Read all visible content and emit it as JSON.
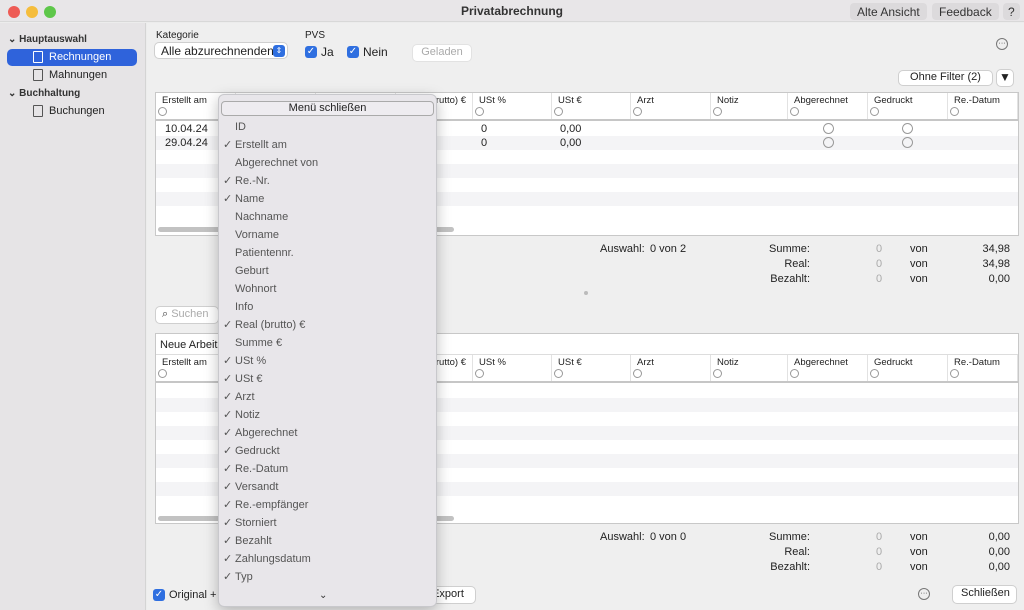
{
  "window": {
    "title": "Privatabrechnung",
    "buttons": [
      "Alte Ansicht",
      "Feedback",
      "?"
    ]
  },
  "sidebar": {
    "sections": [
      {
        "label": "Hauptauswahl",
        "items": [
          {
            "label": "Rechnungen",
            "selected": true,
            "icon": "invoice-icon"
          },
          {
            "label": "Mahnungen",
            "icon": "reminder-icon"
          }
        ]
      },
      {
        "label": "Buchhaltung",
        "items": [
          {
            "label": "Buchungen",
            "icon": "booking-icon"
          }
        ]
      }
    ]
  },
  "filters": {
    "kategorie_label": "Kategorie",
    "kategorie_value": "Alle abzurechnenden",
    "pvs_label": "PVS",
    "ja": "Ja",
    "nein": "Nein",
    "ja_checked": true,
    "nein_checked": true,
    "geladen": "Geladen",
    "ohne_filter": "Ohne Filter (2)"
  },
  "columns": [
    "Erstellt am",
    "Re.-Nr.",
    "Name",
    "Real (brutto) €",
    "USt %",
    "USt €",
    "Arzt",
    "Notiz",
    "Abgerechnet",
    "Gedruckt",
    "Re.-Datum"
  ],
  "table1": {
    "rows": [
      {
        "erstellt": "10.04.24",
        "ust_pct": "0",
        "ust_eur": "0,00"
      },
      {
        "erstellt": "29.04.24",
        "ust_pct": "0",
        "ust_eur": "0,00"
      }
    ]
  },
  "summary1": {
    "auswahl_label": "Auswahl:",
    "auswahl": "0 von 2",
    "summe_label": "Summe:",
    "real_label": "Real:",
    "bezahlt_label": "Bezahlt:",
    "summe": [
      "0",
      "von",
      "34,98"
    ],
    "real": [
      "0",
      "von",
      "34,98"
    ],
    "bezahlt": [
      "0",
      "von",
      "0,00"
    ]
  },
  "search": {
    "placeholder": "Suchen"
  },
  "table2": {
    "title": "Neue Arbeits"
  },
  "summary2": {
    "auswahl_label": "Auswahl:",
    "auswahl": "0 von 0",
    "summe_label": "Summe:",
    "real_label": "Real:",
    "bezahlt_label": "Bezahlt:",
    "summe": [
      "0",
      "von",
      "0,00"
    ],
    "real": [
      "0",
      "von",
      "0,00"
    ],
    "bezahlt": [
      "0",
      "von",
      "0,00"
    ]
  },
  "footer": {
    "original": "Original +",
    "export": "Export",
    "schliessen": "Schließen"
  },
  "menu": {
    "close": "Menü schließen",
    "check": "✓",
    "items": [
      {
        "label": "ID",
        "checked": false
      },
      {
        "label": "Erstellt am",
        "checked": true
      },
      {
        "label": "Abgerechnet von",
        "checked": false
      },
      {
        "label": "Re.-Nr.",
        "checked": true
      },
      {
        "label": "Name",
        "checked": true
      },
      {
        "label": "Nachname",
        "checked": false
      },
      {
        "label": "Vorname",
        "checked": false
      },
      {
        "label": "Patientennr.",
        "checked": false
      },
      {
        "label": "Geburt",
        "checked": false
      },
      {
        "label": "Wohnort",
        "checked": false
      },
      {
        "label": "Info",
        "checked": false
      },
      {
        "label": "Real (brutto) €",
        "checked": true
      },
      {
        "label": "Summe €",
        "checked": false
      },
      {
        "label": "USt %",
        "checked": true
      },
      {
        "label": "USt €",
        "checked": true
      },
      {
        "label": "Arzt",
        "checked": true
      },
      {
        "label": "Notiz",
        "checked": true
      },
      {
        "label": "Abgerechnet",
        "checked": true
      },
      {
        "label": "Gedruckt",
        "checked": true
      },
      {
        "label": "Re.-Datum",
        "checked": true
      },
      {
        "label": "Versandt",
        "checked": true
      },
      {
        "label": "Re.-empfänger",
        "checked": true
      },
      {
        "label": "Storniert",
        "checked": true
      },
      {
        "label": "Bezahlt",
        "checked": true
      },
      {
        "label": "Zahlungsdatum",
        "checked": true
      },
      {
        "label": "Typ",
        "checked": true
      }
    ]
  }
}
